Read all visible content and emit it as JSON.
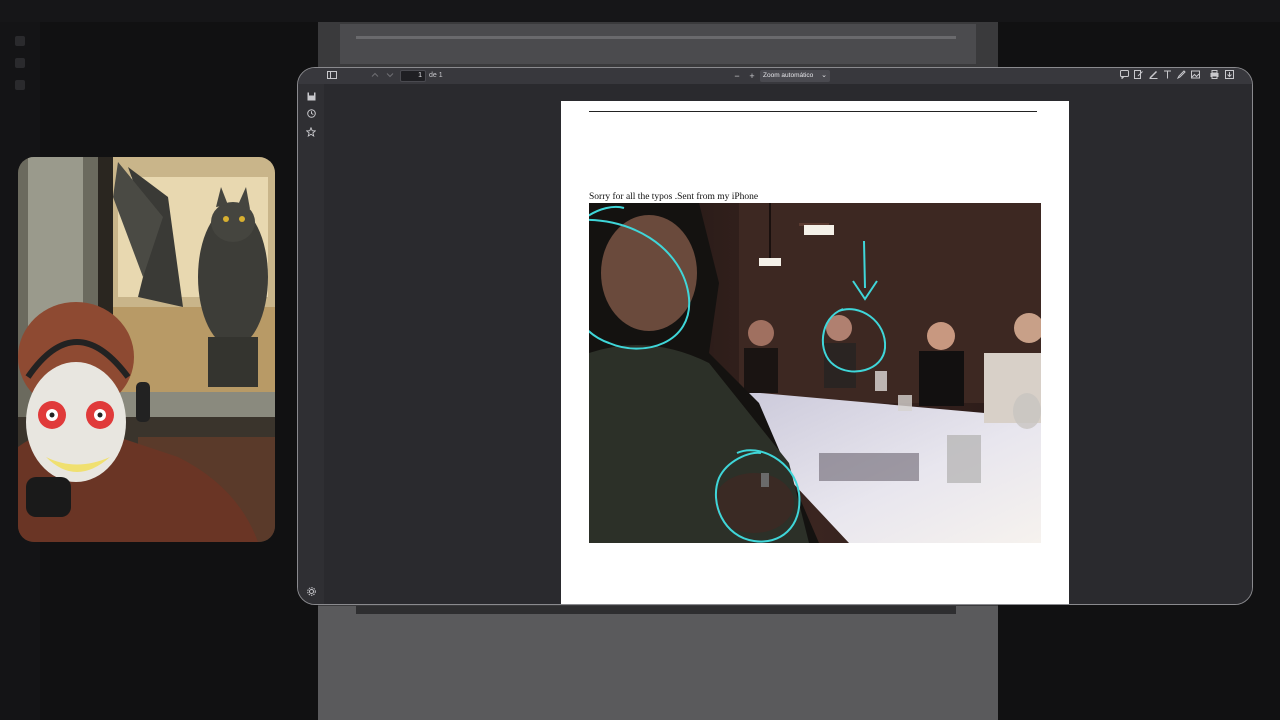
{
  "viewer": {
    "page_number": "1",
    "page_of": "de 1",
    "zoom_minus": "−",
    "zoom_plus": "+",
    "zoom_value": "Zoom automático",
    "caption": "Sorry for all the typos .Sent from my iPhone"
  },
  "icons": {
    "sidebar_toggle": "sidebar-toggle-icon",
    "page_up": "chevron-up-icon",
    "page_down": "chevron-down-icon",
    "comment": "comment-icon",
    "edit_note": "edit-note-icon",
    "highlight": "highlight-pen-icon",
    "text": "text-icon",
    "draw": "draw-pen-icon",
    "image": "image-icon",
    "print": "print-icon",
    "save": "save-icon",
    "history": "history-icon",
    "star": "star-icon",
    "settings": "gear-icon"
  },
  "colors": {
    "annotation": "#3fd6d9",
    "toolbar": "#38383d",
    "viewer_bg": "#2a2a2e"
  }
}
